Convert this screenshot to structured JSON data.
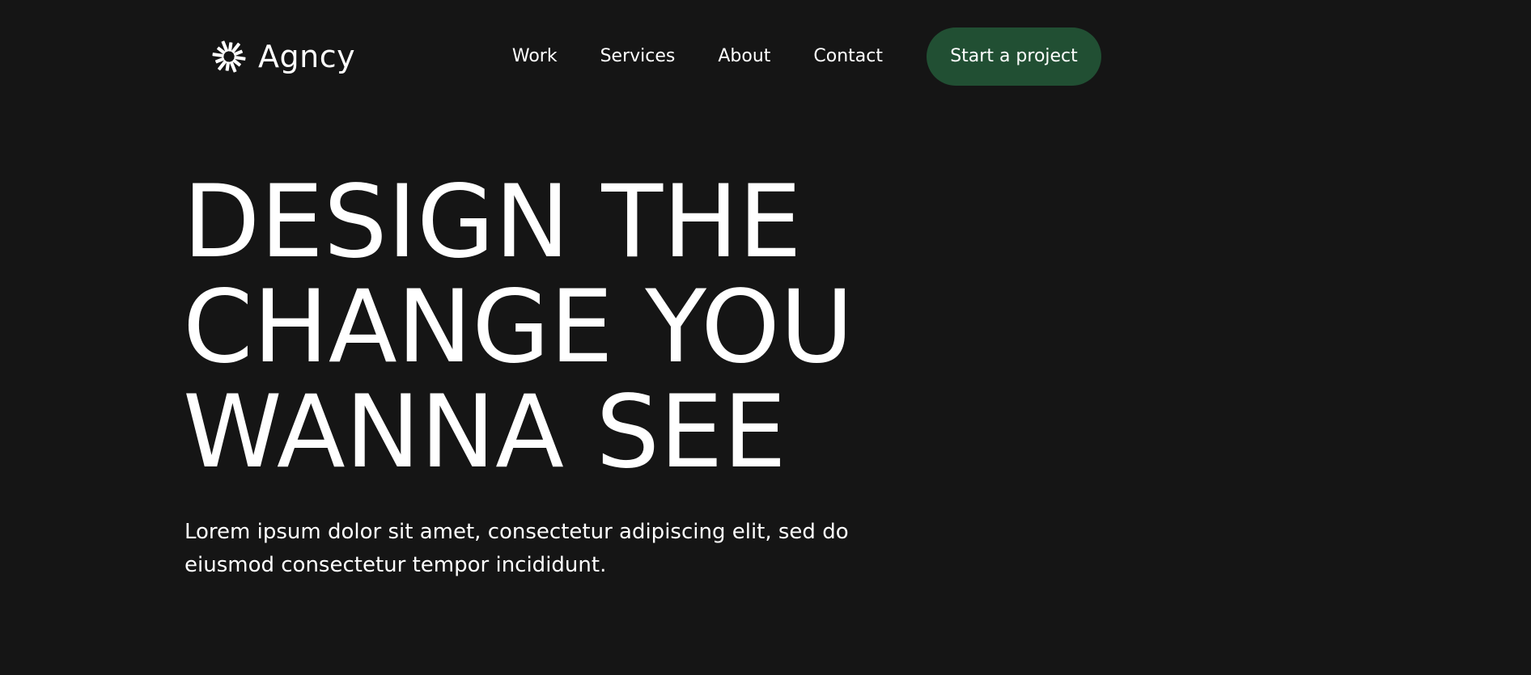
{
  "brand": {
    "name": "Agncy",
    "icon": "sunburst-logo-icon"
  },
  "nav": {
    "links": [
      "Work",
      "Services",
      "About",
      "Contact"
    ],
    "cta_label": "Start a project"
  },
  "hero": {
    "title_lines": [
      "DESIGN THE",
      "CHANGE YOU",
      "WANNA SEE"
    ],
    "subtitle_lines": [
      "Lorem ipsum dolor sit amet, consectetur adipiscing elit, sed do",
      "eiusmod consectetur tempor incididunt."
    ]
  },
  "colors": {
    "background": "#151515",
    "text": "#ffffff",
    "cta_background": "#214f33"
  }
}
